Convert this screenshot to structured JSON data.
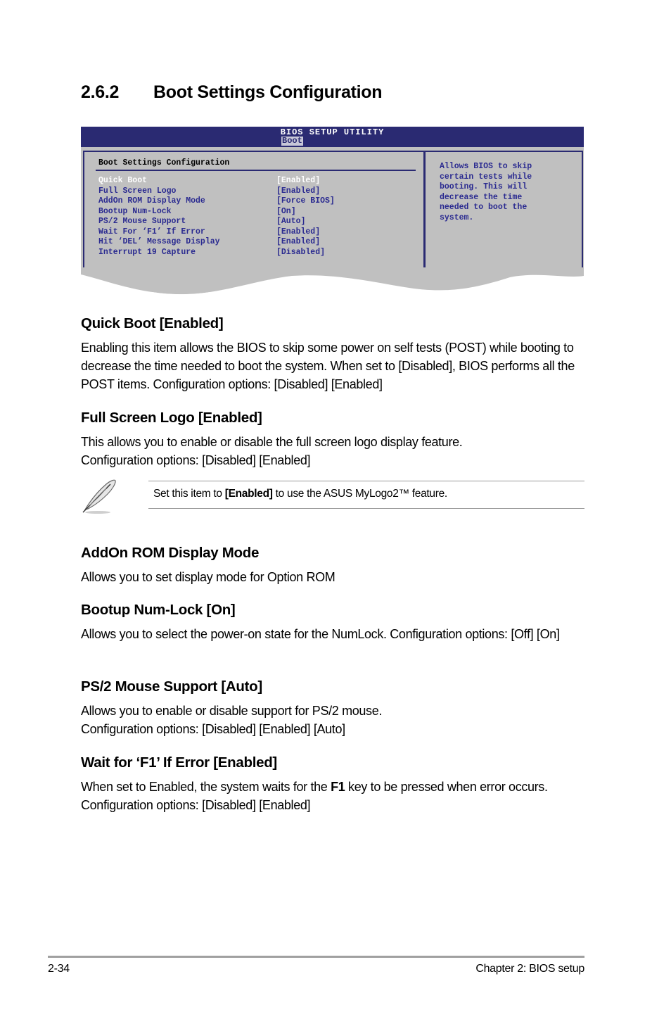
{
  "section": {
    "number": "2.6.2",
    "title": "Boot Settings Configuration"
  },
  "bios": {
    "utility_title": "BIOS SETUP UTILITY",
    "active_tab": "Boot",
    "panel_title": "Boot Settings Configuration",
    "items": [
      {
        "label": "Quick Boot",
        "value": "[Enabled]",
        "selected": true
      },
      {
        "label": "Full Screen Logo",
        "value": "[Enabled]",
        "selected": false
      },
      {
        "label": "AddOn ROM Display Mode",
        "value": "[Force BIOS]",
        "selected": false
      },
      {
        "label": "Bootup Num-Lock",
        "value": "[On]",
        "selected": false
      },
      {
        "label": "PS/2 Mouse Support",
        "value": "[Auto]",
        "selected": false
      },
      {
        "label": "Wait For ‘F1’ If Error",
        "value": "[Enabled]",
        "selected": false
      },
      {
        "label": "Hit ‘DEL’ Message Display",
        "value": "[Enabled]",
        "selected": false
      },
      {
        "label": "Interrupt 19 Capture",
        "value": "[Disabled]",
        "selected": false
      }
    ],
    "help_text": "Allows BIOS to skip\ncertain tests while\nbooting. This will\ndecrease the time\nneeded to boot the\nsystem.",
    "colors": {
      "header_bg": "#2a2a72",
      "panel_bg": "#c0c0c0",
      "item_text": "#2a2a90",
      "selected_text": "#ffffff"
    }
  },
  "topics": [
    {
      "heading": "Quick Boot [Enabled]",
      "body": "Enabling this item allows the BIOS to skip some power on self tests (POST) while booting to decrease the time needed to boot the system. When set to [Disabled], BIOS performs all the POST items. Configuration options: [Disabled] [Enabled]"
    },
    {
      "heading": "Full Screen Logo [Enabled]",
      "body_line1": "This allows you to enable or disable the full screen logo display feature.",
      "body_line2": "Configuration options: [Disabled] [Enabled]"
    },
    {
      "heading": "AddOn ROM Display Mode",
      "body": "Allows you to set display mode for Option ROM"
    },
    {
      "heading": "Bootup Num-Lock [On]",
      "body": "Allows you to select the power-on state for the NumLock. Configuration options: [Off] [On]"
    },
    {
      "heading": "PS/2 Mouse Support [Auto]",
      "body_line1": "Allows you to enable or disable support for PS/2 mouse.",
      "body_line2": "Configuration options: [Disabled] [Enabled] [Auto]"
    },
    {
      "heading": "Wait for ‘F1’ If Error [Enabled]",
      "body_pre": "When set to Enabled, the system waits for the ",
      "body_bold": "F1",
      "body_post": " key to be pressed when error occurs. Configuration options: [Disabled] [Enabled]"
    }
  ],
  "note": {
    "icon": "feather-pen-icon",
    "text_pre": "Set this item to ",
    "text_bold": "[Enabled]",
    "text_post": " to use the ASUS MyLogo2™ feature."
  },
  "footer": {
    "page_number": "2-34",
    "chapter": "Chapter 2: BIOS setup"
  }
}
